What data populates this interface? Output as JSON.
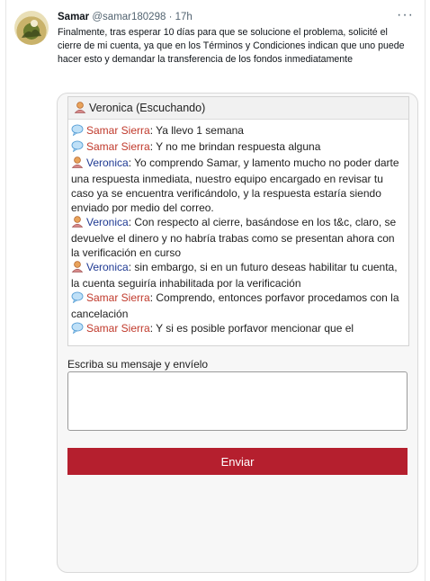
{
  "tweet": {
    "author_name": "Samar",
    "author_handle": "@samar180298",
    "time": "17h",
    "text": "Finalmente, tras esperar 10 días para que se solucione el problema, solicité el cierre de mi cuenta, ya que en los Términos y Condiciones indican que uno puede hacer esto y demandar la transferencia de los fondos inmediatamente",
    "more_icon": "more-icon"
  },
  "chat": {
    "header": "Veronica (Escuchando)",
    "messages": [
      {
        "sender": "Samar Sierra",
        "role": "user",
        "text": "Ya llevo 1 semana"
      },
      {
        "sender": "Samar Sierra",
        "role": "user",
        "text": "Y no me brindan respuesta alguna"
      },
      {
        "sender": "Veronica",
        "role": "agent",
        "text": "Yo comprendo Samar, y lamento mucho no poder darte una respuesta inmediata, nuestro equipo encargado en revisar tu caso ya se encuentra verificándolo, y la respuesta estaría siendo enviado por medio del correo."
      },
      {
        "sender": "Veronica",
        "role": "agent",
        "text": "Con respecto al cierre, basándose en los t&c, claro, se devuelve el dinero y no habría trabas como se presentan ahora con la verificación en curso"
      },
      {
        "sender": "Veronica",
        "role": "agent",
        "text": "sin embargo, si en un futuro deseas habilitar tu cuenta, la cuenta seguiría inhabilitada por la verificación"
      },
      {
        "sender": "Samar Sierra",
        "role": "user",
        "text": "Comprendo, entonces porfavor procedamos con la cancelación"
      },
      {
        "sender": "Samar Sierra",
        "role": "user",
        "text": "Y si es posible porfavor mencionar que el"
      }
    ]
  },
  "form": {
    "label": "Escriba su mensaje y envíelo",
    "input_value": "",
    "send_label": "Enviar"
  },
  "colors": {
    "send_button": "#b51f2e",
    "user_name": "#c0392b",
    "agent_name": "#1f3a93"
  }
}
